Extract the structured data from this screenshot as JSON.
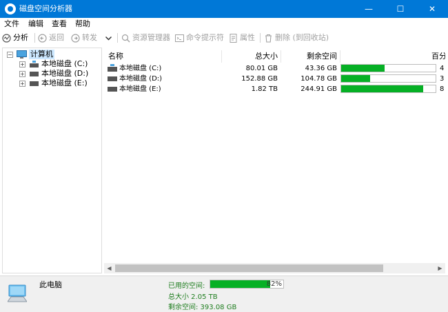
{
  "window": {
    "title": "磁盘空间分析器",
    "minimize": "—",
    "maximize": "☐",
    "close": "✕"
  },
  "menu": [
    "文件",
    "编辑",
    "查看",
    "帮助"
  ],
  "toolbar": {
    "analyze": "分析",
    "back": "返回",
    "forward": "转发",
    "explorer": "资源管理器",
    "cmd": "命令提示符",
    "properties": "属性",
    "delete": "删除 (到回收站)"
  },
  "tree": {
    "root": "计算机",
    "drives": [
      "本地磁盘 (C:)",
      "本地磁盘 (D:)",
      "本地磁盘 (E:)"
    ]
  },
  "list": {
    "headers": {
      "name": "名称",
      "total": "总大小",
      "free": "剩余空间",
      "percent": "百分"
    },
    "rows": [
      {
        "name": "本地磁盘 (C:)",
        "total": "80.01 GB",
        "free": "43.36 GB",
        "used_fraction": 0.46,
        "pct_text": "4"
      },
      {
        "name": "本地磁盘 (D:)",
        "total": "152.88 GB",
        "free": "104.78 GB",
        "used_fraction": 0.31,
        "pct_text": "3"
      },
      {
        "name": "本地磁盘 (E:)",
        "total": "1.82 TB",
        "free": "244.91 GB",
        "used_fraction": 0.87,
        "pct_text": "8"
      }
    ]
  },
  "status": {
    "computer_name": "此电脑",
    "used_label": "已用的空间:",
    "used_fraction": 0.82,
    "used_pct_text": "82%",
    "total_line": "总大小 2.05 TB",
    "free_line": "剩余空间: 393.08 GB"
  },
  "colors": {
    "accent": "#0078d7",
    "bar": "#06b025"
  }
}
